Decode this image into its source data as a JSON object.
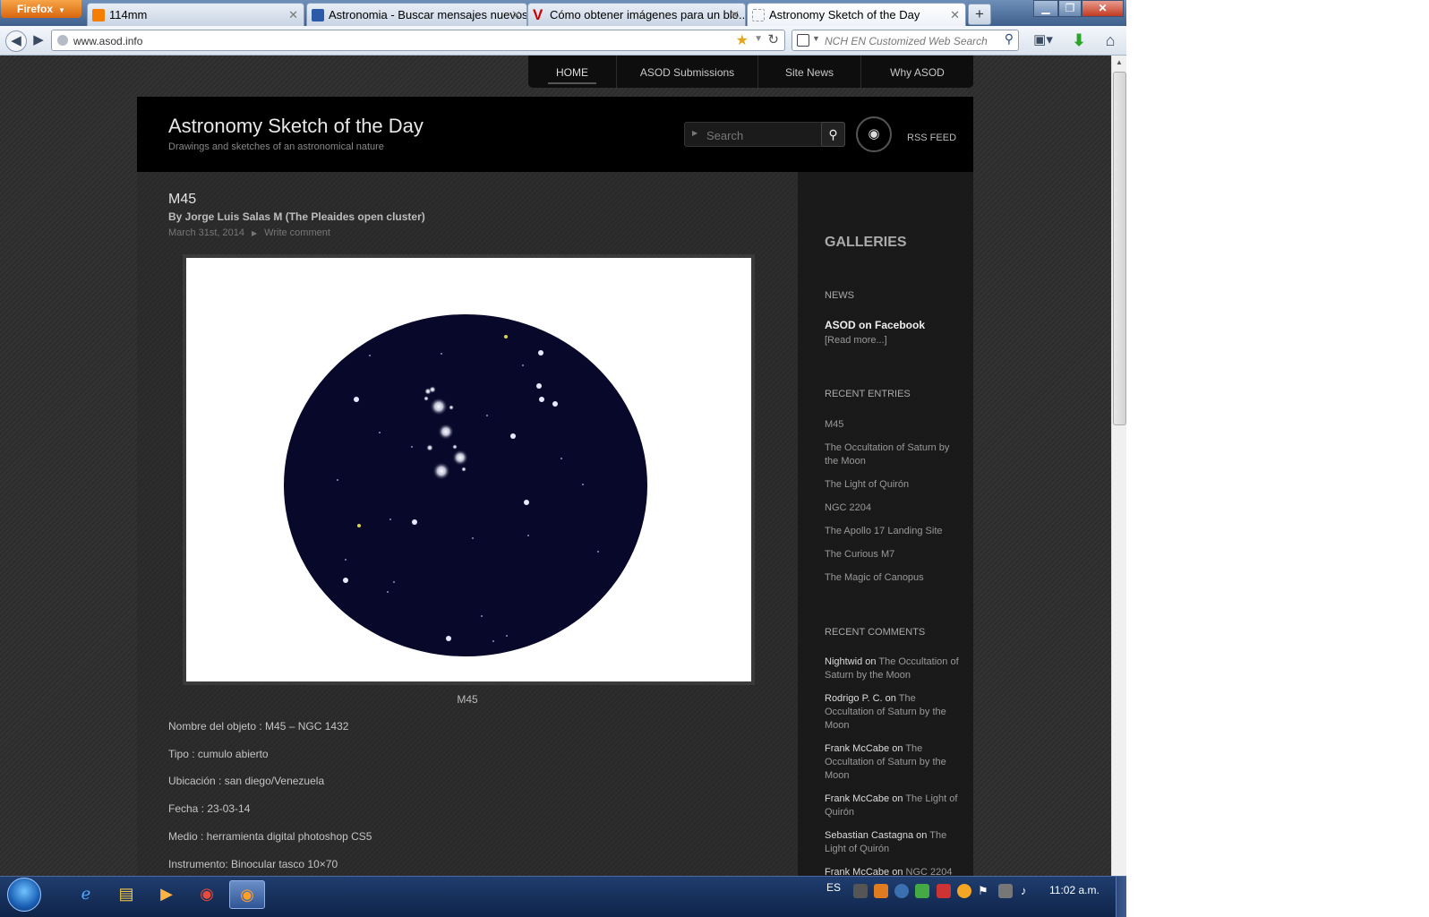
{
  "browser": {
    "menu_button": "Firefox",
    "tabs": [
      {
        "title": "114mm",
        "favicon_color": "#f57d00"
      },
      {
        "title": "Astronomia - Buscar mensajes nuevos",
        "favicon_color": "#2a5aa8"
      },
      {
        "title": "Cómo obtener imágenes para un blo...",
        "favicon_color": "#cc0000"
      },
      {
        "title": "Astronomy Sketch of the Day",
        "favicon_color": "#ffffff"
      }
    ],
    "new_tab_label": "+",
    "url": "www.asod.info",
    "search_placeholder": "NCH EN Customized Web Search"
  },
  "site": {
    "nav": [
      "HOME",
      "ASOD Submissions",
      "Site News",
      "Why ASOD"
    ],
    "title": "Astronomy Sketch of the Day",
    "tagline": "Drawings and sketches of an astronomical nature",
    "search_placeholder": "Search",
    "rss_label": "RSS FEED"
  },
  "post": {
    "title": "M45",
    "author": "By Jorge Luis Salas M (The Pleaides open cluster)",
    "date": "March 31st, 2014",
    "comment_link": "Write comment",
    "image_caption": "M45",
    "details": [
      "Nombre del objeto : M45 – NGC 1432",
      "Tipo : cumulo abierto",
      "Ubicación : san diego/Venezuela",
      "Fecha : 23-03-14",
      "Medio : herramienta digital photoshop CS5",
      "Instrumento: Binocular tasco 10×70"
    ]
  },
  "sidebar": {
    "galleries_heading": "GALLERIES",
    "news_heading": "NEWS",
    "news_item_title": "ASOD on Facebook",
    "news_item_link": "[Read more...]",
    "recent_entries_heading": "RECENT ENTRIES",
    "recent_entries": [
      "M45",
      "The Occultation of Saturn by the Moon",
      "The Light of Quirón",
      "NGC 2204",
      "The Apollo 17 Landing Site",
      "The Curious M7",
      "The Magic of Canopus"
    ],
    "recent_comments_heading": "RECENT COMMENTS",
    "recent_comments": [
      {
        "author": "Nightwid",
        "on": "on",
        "post": "The Occultation of Saturn by the Moon"
      },
      {
        "author": "Rodrigo P. C.",
        "on": "on",
        "post": "The Occultation of Saturn by the Moon"
      },
      {
        "author": "Frank McCabe",
        "on": "on",
        "post": "The Occultation of Saturn by the Moon"
      },
      {
        "author": "Frank McCabe",
        "on": "on",
        "post": "The Light of Quirón"
      },
      {
        "author": "Sebastian Castagna",
        "on": "on",
        "post": "The Light of Quirón"
      },
      {
        "author": "Frank McCabe",
        "on": "on",
        "post": "NGC 2204"
      }
    ]
  },
  "taskbar": {
    "language": "ES",
    "clock": "11:02 a.m.",
    "pinned": [
      "internet-explorer",
      "file-explorer",
      "media-player",
      "chrome",
      "firefox"
    ]
  }
}
